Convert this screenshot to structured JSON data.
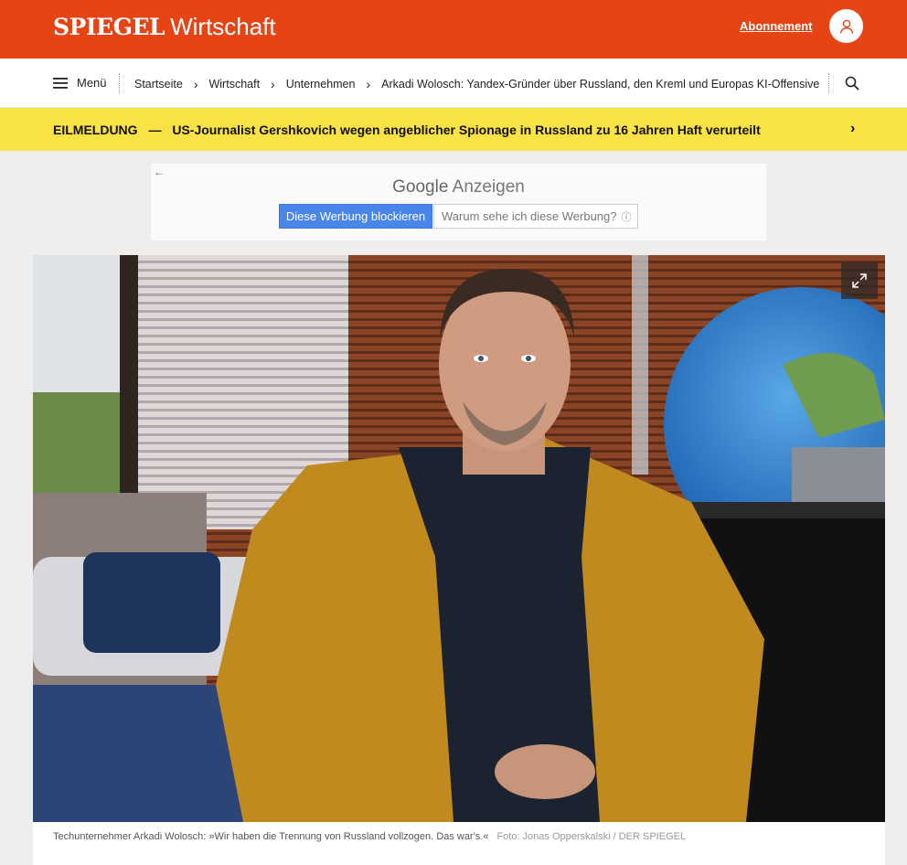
{
  "header": {
    "brand": "SPIEGEL",
    "section": "Wirtschaft",
    "subscription_label": "Abonnement",
    "brand_color": "#e64415"
  },
  "nav": {
    "menu_label": "Menü",
    "breadcrumbs": [
      "Startseite",
      "Wirtschaft",
      "Unternehmen",
      "Arkadi Wolosch: Yandex-Gründer über Russland, den Kreml und Europas KI-Offensive"
    ]
  },
  "breaking": {
    "label": "EILMELDUNG",
    "dash": "—",
    "headline": "US-Journalist Gershkovich wegen angeblicher Spionage in Russland zu 16 Jahren Haft verurteilt",
    "color": "#f9e246"
  },
  "ad": {
    "title_google": "Google",
    "title_rest": "Anzeigen",
    "block_label": "Diese Werbung blockieren",
    "why_label": "Warum sehe ich diese Werbung?"
  },
  "article": {
    "caption": "Techunternehmer Arkadi Wolosch: »Wir haben die Trennung von Russland vollzogen. Das war's.«",
    "credit": "Foto: Jonas Opperskalski / DER SPIEGEL"
  }
}
